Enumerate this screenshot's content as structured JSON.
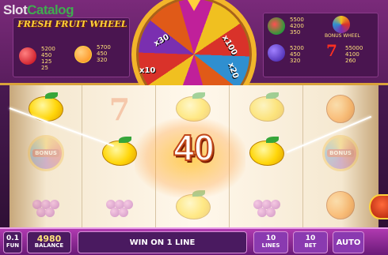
{
  "logo": {
    "part1": "Slot",
    "part2": "Catalog"
  },
  "game": {
    "title": "FRESH FRUIT WHEEL"
  },
  "paytable": {
    "left": [
      {
        "icon": "cherries-icon",
        "pays": [
          "5200",
          "450",
          "125",
          "25"
        ]
      },
      {
        "icon": "orange-icon",
        "pays": [
          "5700",
          "450",
          "320"
        ]
      }
    ],
    "right": [
      {
        "icon": "watermelon-icon",
        "pays": [
          "5500",
          "4200",
          "350"
        ]
      },
      {
        "icon": "bonus-wheel-icon",
        "label": "BONUS WHEEL"
      },
      {
        "icon": "plum-icon",
        "pays": [
          "5200",
          "450",
          "320"
        ]
      },
      {
        "icon": "seven-icon",
        "pays": [
          "55000",
          "4100",
          "260"
        ]
      }
    ]
  },
  "wheel": {
    "labels": [
      "x30",
      "x100",
      "x10",
      "x20"
    ]
  },
  "win": {
    "amount": "40"
  },
  "bottom": {
    "fun_value": "0.1",
    "fun_label": "FUN",
    "balance_value": "4980",
    "balance_label": "BALANCE",
    "win_text": "WIN ON 1 LINE",
    "lines_value": "10",
    "lines_label": "LINES",
    "bet_value": "10",
    "bet_label": "BET",
    "auto_label": "AUTO"
  },
  "colors": {
    "accent": "#ffd23a",
    "bar": "#b03ab0",
    "panel": "#4a1550"
  }
}
